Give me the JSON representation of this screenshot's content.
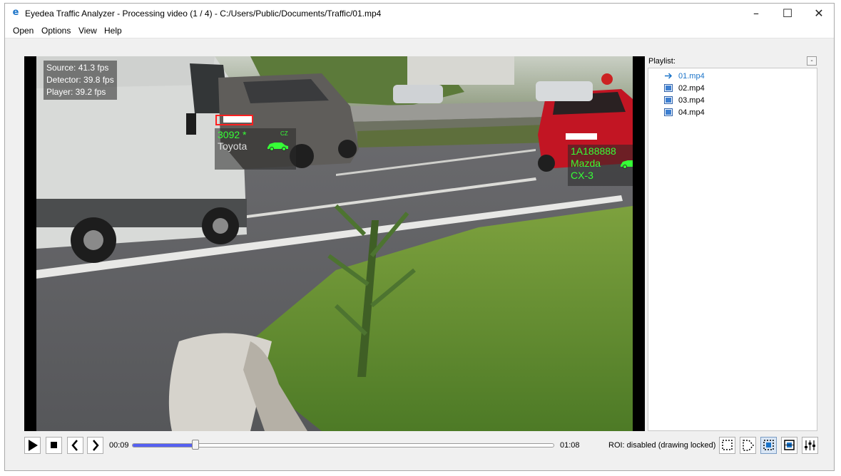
{
  "window": {
    "title": "Eyedea Traffic Analyzer - Processing video (1 / 4) - C:/Users/Public/Documents/Traffic/01.mp4",
    "app_icon": "e",
    "minimize": "–",
    "maximize": "☐",
    "close": "✕"
  },
  "menu": {
    "items": [
      "Open",
      "Options",
      "View",
      "Help"
    ]
  },
  "video": {
    "stats": {
      "source": "Source: 41.3 fps",
      "detector": "Detector: 39.8 fps",
      "player": "Player: 39.2 fps"
    },
    "detections": [
      {
        "plate": "3092 *",
        "country": "CZ",
        "make": "Toyota",
        "model": "",
        "plate_box_text": "3092"
      },
      {
        "plate": "1A188888",
        "country": "CZ",
        "make": "Mazda",
        "model": "CX-3",
        "plate_box_text": "1A18 8888"
      }
    ]
  },
  "playlist": {
    "label": "Playlist:",
    "collapse": "-",
    "items": [
      {
        "name": "01.mp4",
        "current": true
      },
      {
        "name": "02.mp4",
        "current": false
      },
      {
        "name": "03.mp4",
        "current": false
      },
      {
        "name": "04.mp4",
        "current": false
      }
    ]
  },
  "player": {
    "current_time": "00:09",
    "total_time": "01:08",
    "progress": 0.15,
    "roi_status": "ROI: disabled (drawing locked)"
  },
  "colors": {
    "accent": "#5560f2",
    "detection_text": "#36ff36",
    "plate_box": "#ff2020",
    "current_item": "#1a73c8"
  },
  "icons": {
    "play": "play-icon",
    "stop": "stop-icon",
    "prev": "chevron-left-icon",
    "next": "chevron-right-icon",
    "roi_tools": [
      "roi-rect-icon",
      "roi-polygon-icon",
      "roi-select-icon",
      "roi-grid-icon",
      "settings-sliders-icon"
    ]
  }
}
